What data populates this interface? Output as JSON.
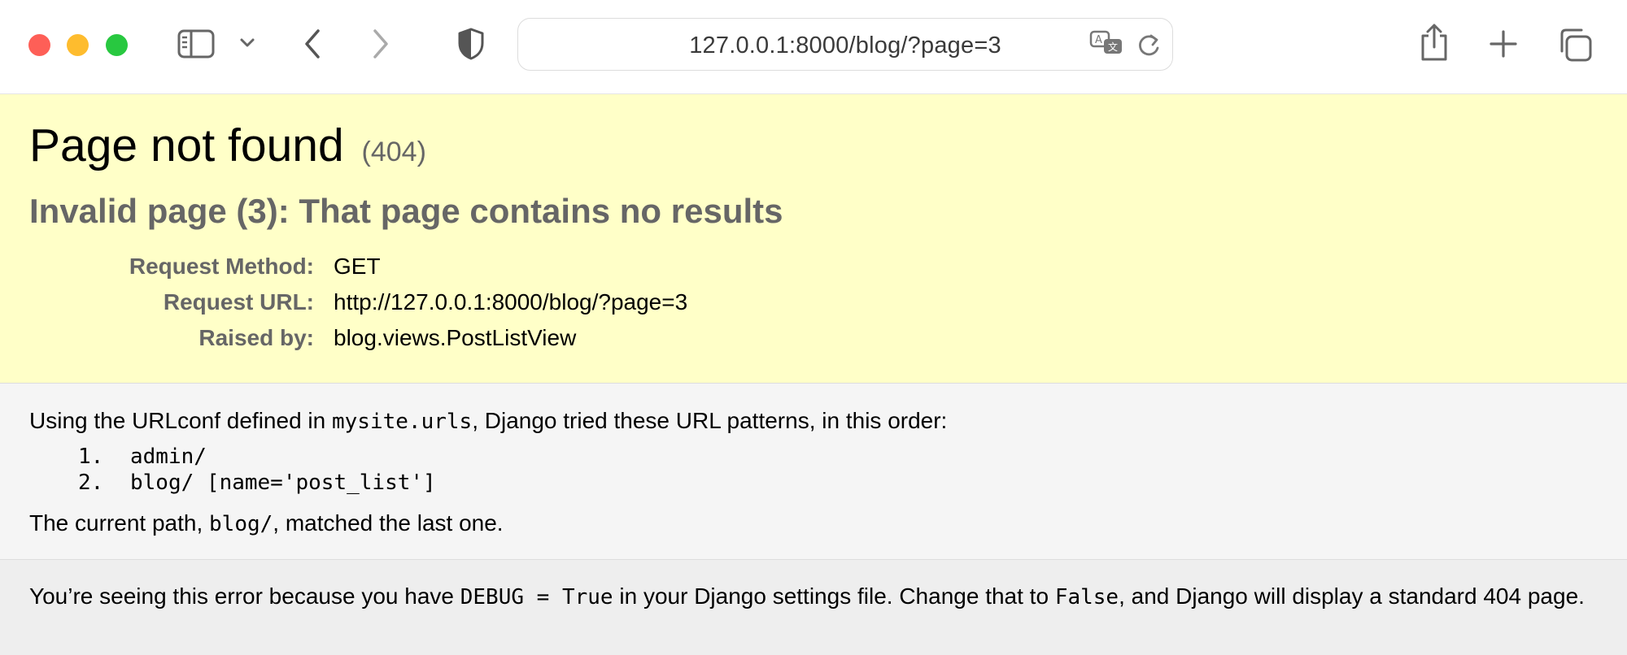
{
  "browser": {
    "url": "127.0.0.1:8000/blog/?page=3",
    "icons": [
      "sidebar-icon",
      "chevron-down-icon",
      "back-icon",
      "forward-icon",
      "shield-icon",
      "translate-icon",
      "reload-icon",
      "share-icon",
      "new-tab-icon",
      "tabs-overview-icon"
    ],
    "colors": {
      "close": "#fe5f57",
      "minimize": "#febc2e",
      "zoom": "#28c840"
    }
  },
  "summary": {
    "title": "Page not found",
    "status_code": "(404)",
    "subtitle": "Invalid page (3): That page contains no results",
    "rows": [
      {
        "label": "Request Method:",
        "value": "GET"
      },
      {
        "label": "Request URL:",
        "value": "http://127.0.0.1:8000/blog/?page=3"
      },
      {
        "label": "Raised by:",
        "value": "blog.views.PostListView"
      }
    ],
    "background": "#ffffc8"
  },
  "info": {
    "intro_before": "Using the URLconf defined in ",
    "intro_code": "mysite.urls",
    "intro_after": ", Django tried these URL patterns, in this order:",
    "patterns": [
      {
        "num": "1.",
        "pattern": "admin/"
      },
      {
        "num": "2.",
        "pattern": "blog/ [name='post_list']"
      }
    ],
    "current_before": "The current path, ",
    "current_code": "blog/",
    "current_after": ", matched the last one."
  },
  "explanation": {
    "text1": "You’re seeing this error because you have ",
    "code1": "DEBUG = True",
    "text2": " in your Django settings file. Change that to ",
    "code2": "False",
    "text3": ", and Django will display a standard 404 page."
  }
}
